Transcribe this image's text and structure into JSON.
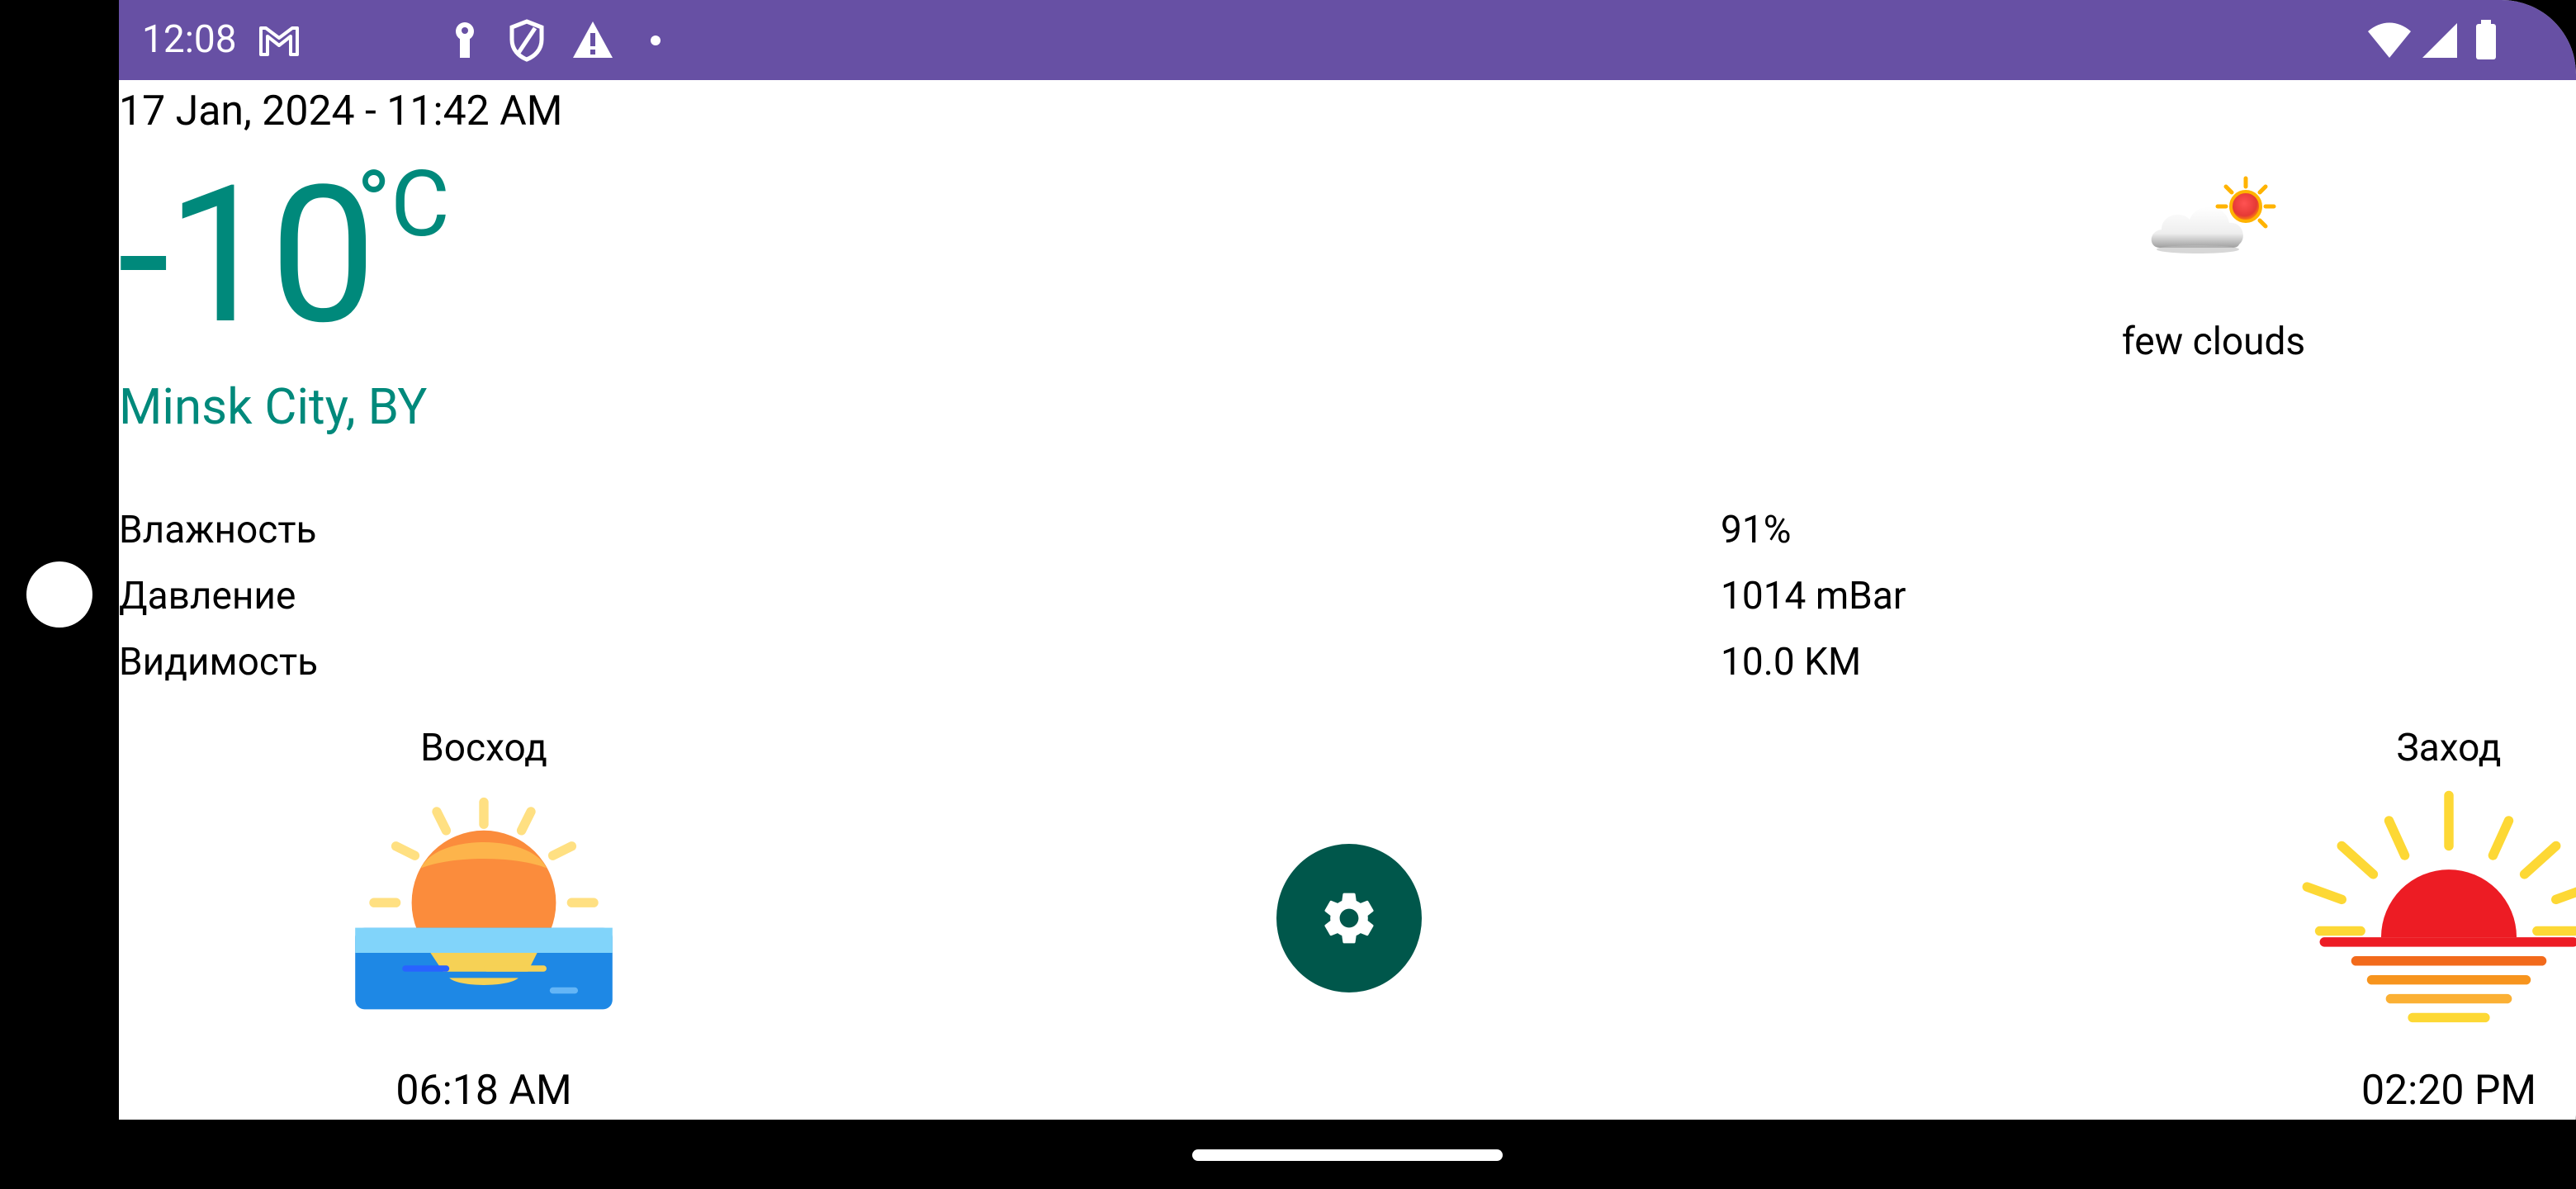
{
  "status_bar": {
    "time": "12:08",
    "background": "#6750A4",
    "left_icons": [
      "gmail-icon",
      "key-icon",
      "shield-icon",
      "warning-icon",
      "dot-icon"
    ],
    "right_icons": [
      "wifi-icon",
      "cell-signal-icon",
      "battery-icon"
    ]
  },
  "weather": {
    "datetime": "17 Jan, 2024 - 11:42 AM",
    "temperature": "-10",
    "unit": "°C",
    "city": "Minsk City, BY",
    "condition": "few clouds",
    "condition_icon": "few-clouds-icon",
    "accent_color": "#00897B"
  },
  "details": [
    {
      "label": "Влажность",
      "value": "91%"
    },
    {
      "label": "Давление",
      "value": "1014 mBar"
    },
    {
      "label": "Видимость",
      "value": "10.0 KM"
    }
  ],
  "sunrise": {
    "label": "Восход",
    "time": "06:18 AM",
    "icon": "sunrise-icon"
  },
  "sunset": {
    "label": "Заход",
    "time": "02:20 PM",
    "icon": "sunset-icon"
  },
  "settings_button": {
    "icon": "gear-icon",
    "color": "#00574B"
  }
}
